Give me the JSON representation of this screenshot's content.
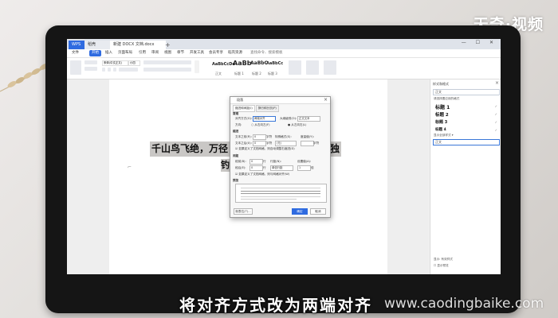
{
  "watermark": "天奇·视频",
  "subtitle": "将对齐方式改为两端对齐",
  "site_watermark": "www.caodingbaike.com",
  "window": {
    "tabs": [
      "WPS",
      "稻壳",
      "新建 DOCX 文档.docx",
      "+"
    ],
    "window_controls": "— ☐ ✕"
  },
  "menu": [
    "文件",
    "开始",
    "插入",
    "页面布局",
    "引用",
    "审阅",
    "视图",
    "章节",
    "开发工具",
    "会员专享",
    "稻壳资源",
    "查找命令、搜索模板"
  ],
  "ribbon": {
    "font_name": "宋体(中文正文)",
    "font_size": "小四",
    "style_samples": [
      "AaBbCcDd",
      "AaBb",
      "AaBbC",
      "AaBbCc"
    ],
    "style_names": [
      "正文",
      "标题 1",
      "标题 2",
      "标题 3"
    ]
  },
  "document": {
    "line1": "千山鸟飞绝，万径",
    "line1_end": "独",
    "line2": "钓"
  },
  "dialog": {
    "title": "段落",
    "tabs": [
      "缩进和间距(I)",
      "换行和分页(P)"
    ],
    "section_general": "常规",
    "alignment_label": "对齐方式(G):",
    "alignment_value": "两端对齐",
    "outline_label": "大纲级别(O):",
    "outline_value": "正文文本",
    "direction_label": "方向:",
    "direction_rtl": "从右向左(F)",
    "direction_ltr": "从左向右(L)",
    "section_indent": "缩进",
    "indent_before": "文本之前(R):",
    "indent_after": "文本之后(X):",
    "special_label": "特殊格式(S):",
    "special_value": "(无)",
    "measure_label": "度量值(Y):",
    "indent_value": "0",
    "unit_char": "字符",
    "grid_indent_check": "如果定义了文档网格，则自动调整右缩进(D)",
    "section_spacing": "间距",
    "space_before": "段前(B):",
    "space_after": "段后(E):",
    "line_spacing_label": "行距(N):",
    "line_spacing_value": "单倍行距",
    "setting_label": "设置值(A):",
    "spacing_value": "0",
    "unit_line": "行",
    "setting_value": "1",
    "setting_unit": "倍",
    "grid_align_check": "如果定义了文档网格，则与网格对齐(W)",
    "section_preview": "预览",
    "btn_tabs": "制表位(T)...",
    "btn_ok": "确定",
    "btn_cancel": "取消"
  },
  "panel": {
    "title": "样式和格式",
    "current_style": "正文",
    "apply_label": "请选择要应用的格式",
    "styles": [
      "标题 1",
      "标题 2",
      "标题 3",
      "标题 4"
    ],
    "show_all": "显示全部样式 ▾",
    "selected": "正文",
    "foot1": "显示: 有效样式",
    "foot2": "显示预览"
  },
  "colors": {
    "accent": "#2f6be0",
    "monitor": "#151515",
    "highlight": "#c9c7c5"
  }
}
